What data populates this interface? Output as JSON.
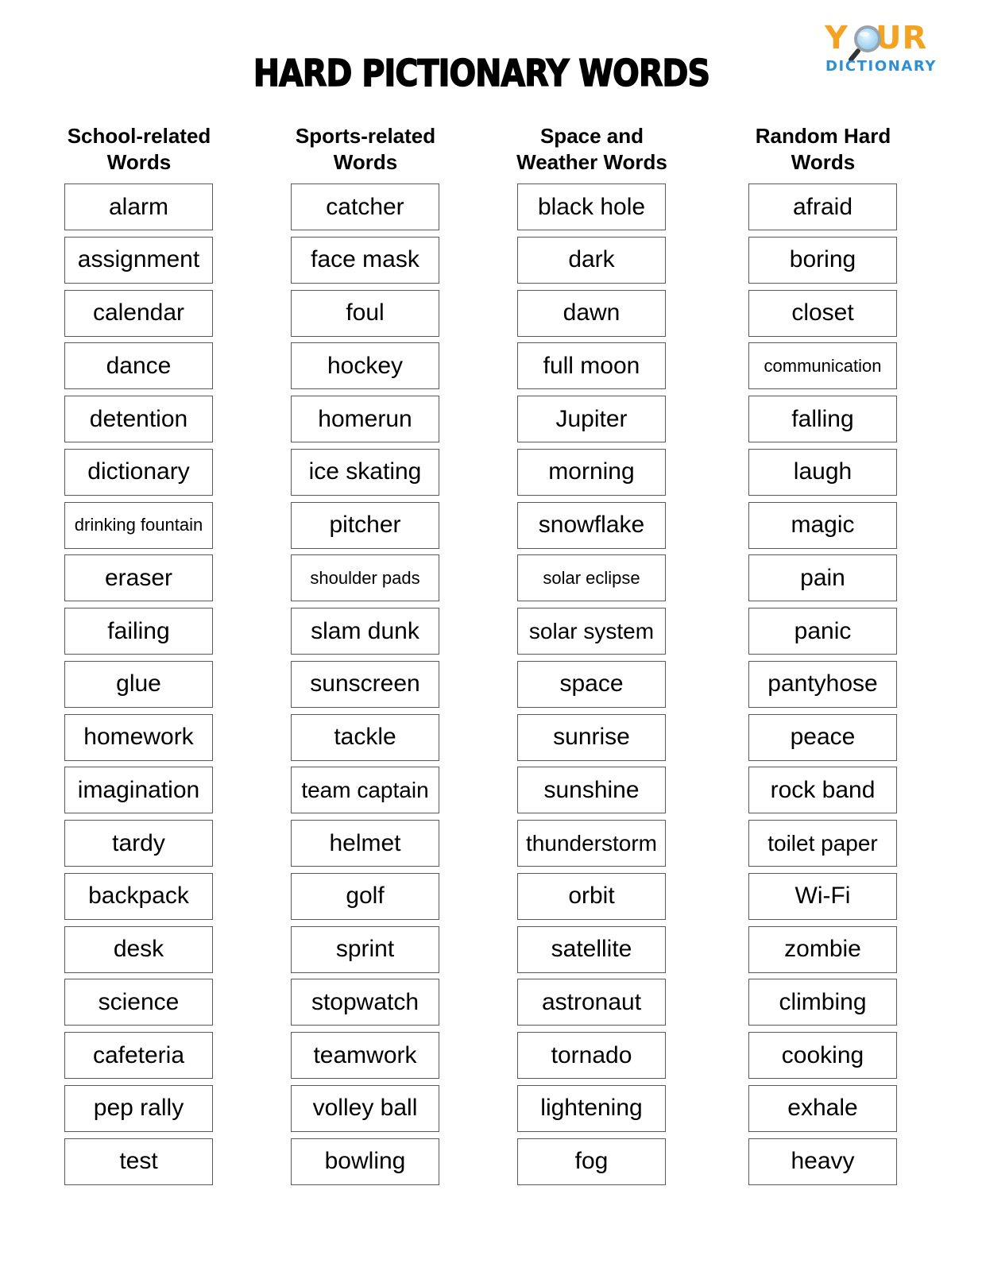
{
  "page": {
    "title": "HARD PICTIONARY WORDS",
    "logo": {
      "line1": "Y  UR",
      "line1_left": "Y",
      "line1_right": "UR",
      "line2": "DICTIONARY",
      "icon": "magnifying-glass-icon",
      "colors": {
        "your": "#f4a221",
        "dictionary": "#2f8fd3"
      }
    }
  },
  "columns": [
    {
      "heading_line1": "School-related",
      "heading_line2": "Words",
      "words": [
        "alarm",
        "assignment",
        "calendar",
        "dance",
        "detention",
        "dictionary",
        "drinking fountain",
        "eraser",
        "failing",
        "glue",
        "homework",
        "imagination",
        "tardy",
        "backpack",
        "desk",
        "science",
        "cafeteria",
        "pep rally",
        "test"
      ]
    },
    {
      "heading_line1": "Sports-related",
      "heading_line2": "Words",
      "words": [
        "catcher",
        "face mask",
        "foul",
        "hockey",
        "homerun",
        "ice skating",
        "pitcher",
        "shoulder pads",
        "slam dunk",
        "sunscreen",
        "tackle",
        "team captain",
        "helmet",
        "golf",
        "sprint",
        "stopwatch",
        "teamwork",
        "volley ball",
        "bowling"
      ]
    },
    {
      "heading_line1": "Space and",
      "heading_line2": "Weather Words",
      "words": [
        "black hole",
        "dark",
        "dawn",
        "full moon",
        "Jupiter",
        "morning",
        "snowflake",
        "solar eclipse",
        "solar system",
        "space",
        "sunrise",
        "sunshine",
        "thunderstorm",
        "orbit",
        "satellite",
        "astronaut",
        "tornado",
        "lightening",
        "fog"
      ]
    },
    {
      "heading_line1": "Random Hard",
      "heading_line2": "Words",
      "words": [
        "afraid",
        "boring",
        "closet",
        "communication",
        "falling",
        "laugh",
        "magic",
        "pain",
        "panic",
        "pantyhose",
        "peace",
        "rock band",
        "toilet paper",
        "Wi-Fi",
        "zombie",
        "climbing",
        "cooking",
        "exhale",
        "heavy"
      ]
    }
  ]
}
